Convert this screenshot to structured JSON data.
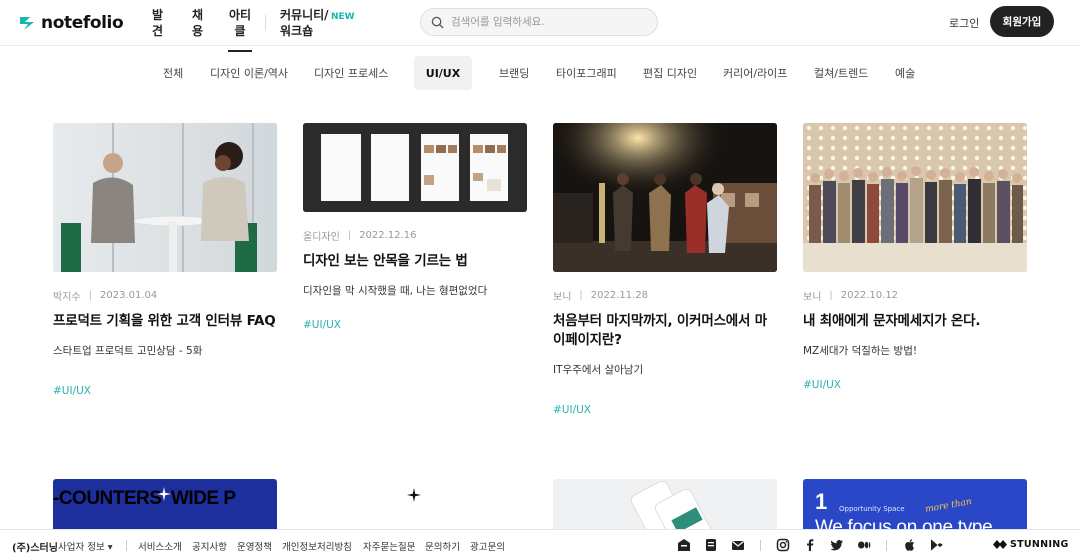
{
  "header": {
    "logo_text": "notefolio",
    "nav": [
      {
        "label": "발\n견"
      },
      {
        "label": "채\n용"
      },
      {
        "label": "아티\n클"
      },
      {
        "label": "커뮤니티/\n워크숍"
      }
    ],
    "new_badge": "NEW",
    "search_placeholder": "검색어를 입력하세요.",
    "login": "로그인",
    "signup": "회원가입"
  },
  "categories": [
    {
      "label": "전체"
    },
    {
      "label": "디자인 이론/역사"
    },
    {
      "label": "디자인 프로세스"
    },
    {
      "label": "UI/UX"
    },
    {
      "label": "브랜딩"
    },
    {
      "label": "타이포그래피"
    },
    {
      "label": "편집 디자인"
    },
    {
      "label": "커리어/라이프"
    },
    {
      "label": "컬쳐/트렌드"
    },
    {
      "label": "예술"
    }
  ],
  "active_category": "UI/UX",
  "articles": [
    {
      "author": "박지수",
      "date": "2023.01.04",
      "title": "프로덕트 기획을 위한 고객 인터뷰 FAQ",
      "desc": "스타트업 프로덕트 고민상담 - 5화",
      "tag": "#UI/UX"
    },
    {
      "author": "올디자인",
      "date": "2022.12.16",
      "title": "디자인 보는 안목을 기르는 법",
      "desc": "디자인을 막 시작했을 때, 나는 형편없었다",
      "tag": "#UI/UX"
    },
    {
      "author": "보니",
      "date": "2022.11.28",
      "title": "처음부터 마지막까지, 이커머스에서 마이페이지란?",
      "desc": "IT우주에서 살아남기",
      "tag": "#UI/UX"
    },
    {
      "author": "보니",
      "date": "2022.10.12",
      "title": "내 최애에게 문자메세지가 온다.",
      "desc": "MZ세대가 덕질하는 방법!",
      "tag": "#UI/UX"
    }
  ],
  "row2": {
    "thumb1_text": "-COUNTERS  WIDE P",
    "thumb4_number": "1",
    "thumb4_small": "Opportunity Space",
    "thumb4_handwrite": "more than",
    "thumb4_text": "We focus on one type"
  },
  "footer": {
    "company": "(주)스터닝",
    "info": "사업자 정보 ▾",
    "links": [
      "서비스소개",
      "공지사항",
      "운영정책",
      "개인정보처리방침",
      "자주묻는질문",
      "문의하기",
      "광고문의"
    ],
    "brand": "STUNNING"
  },
  "colors": {
    "accent": "#14b8b0",
    "tag": "#2ab0ad",
    "dark": "#222222"
  }
}
